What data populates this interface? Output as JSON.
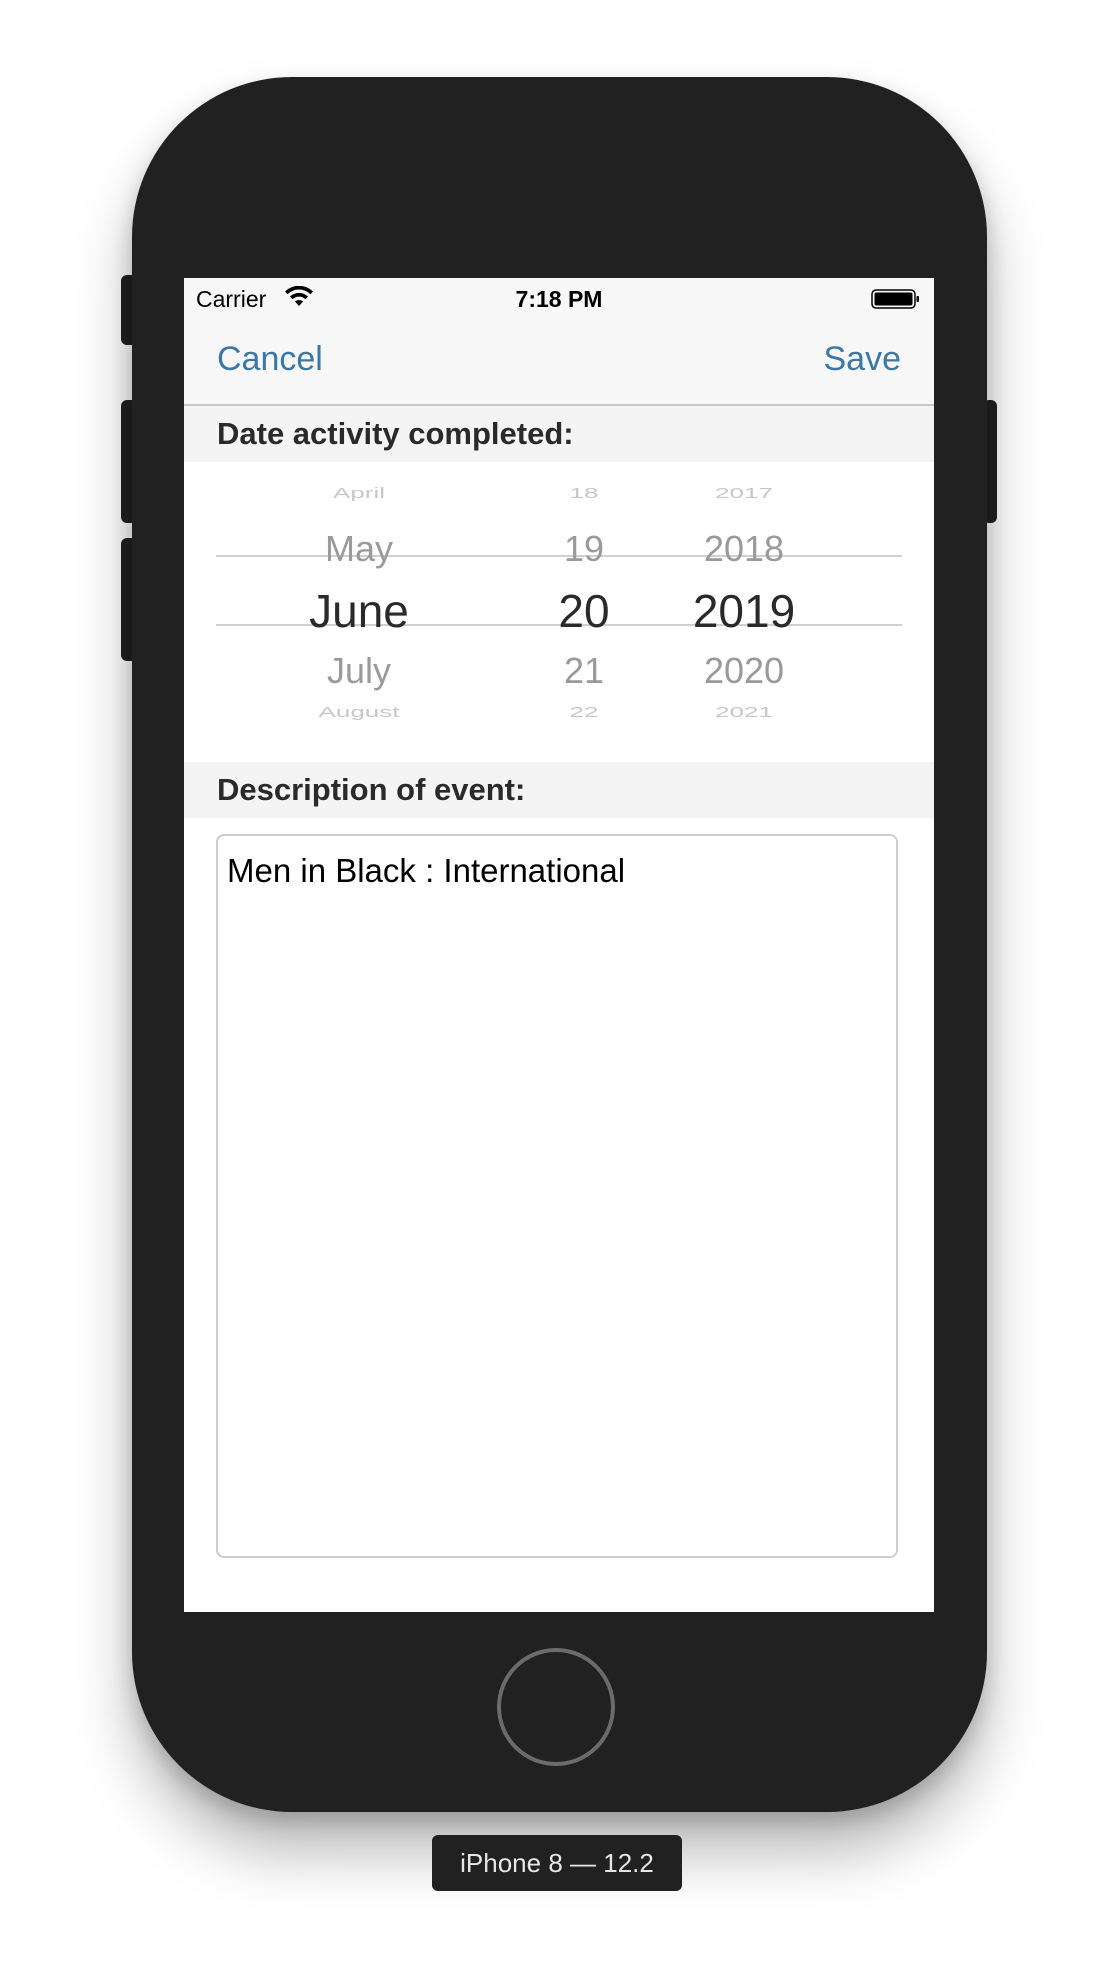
{
  "status_bar": {
    "carrier": "Carrier",
    "time": "7:18 PM",
    "wifi_icon": "wifi-icon",
    "battery_icon": "battery-icon"
  },
  "nav": {
    "cancel_label": "Cancel",
    "save_label": "Save",
    "accent_color": "#3a78a6"
  },
  "date_section": {
    "header": "Date activity completed:",
    "picker": {
      "months": [
        "April",
        "May",
        "June",
        "July",
        "August"
      ],
      "days": [
        "18",
        "19",
        "20",
        "21",
        "22"
      ],
      "years": [
        "2017",
        "2018",
        "2019",
        "2020",
        "2021"
      ],
      "selected": {
        "month": "June",
        "day": "20",
        "year": "2019"
      }
    }
  },
  "description_section": {
    "header": "Description of event:",
    "value": "Men in Black : International"
  },
  "device": {
    "label": "iPhone 8 — 12.2",
    "body_color": "#212121"
  }
}
